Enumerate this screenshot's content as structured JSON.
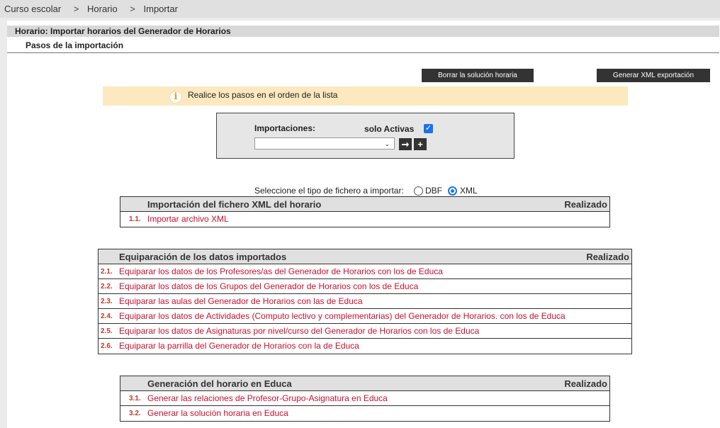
{
  "breadcrumb": [
    "Curso escolar",
    "Horario",
    "Importar"
  ],
  "breadcrumb_sep": ">",
  "page_title": "Horario: Importar horarios del Generador de Horarios",
  "section_title": "Pasos de la importación",
  "buttons": {
    "borrar": "Borrar la solución horaria",
    "generar_xml": "Generar XML exportación"
  },
  "info_message": "Realice los pasos en el orden de la lista",
  "importaciones": {
    "label": "Importaciones:",
    "solo_activas_label": "solo Activas",
    "solo_activas_checked": true,
    "selected_value": ""
  },
  "filetype": {
    "prompt": "Seleccione el tipo de fichero a importar:",
    "options": [
      "DBF",
      "XML"
    ],
    "selected": "XML"
  },
  "tables": [
    {
      "title": "Importación del fichero XML del horario",
      "done_header": "Realizado",
      "rows": [
        {
          "num": "1.1.",
          "label": "Importar archivo XML"
        }
      ]
    },
    {
      "title": "Equiparación de los datos importados",
      "done_header": "Realizado",
      "rows": [
        {
          "num": "2.1.",
          "label": "Equiparar los datos de los Profesores/as del Generador de Horarios con los de Educa"
        },
        {
          "num": "2.2.",
          "label": "Equiparar los datos de los Grupos del Generador de Horarios con los de Educa"
        },
        {
          "num": "2.3.",
          "label": "Equiparar las aulas del Generador de Horarios con las de Educa"
        },
        {
          "num": "2.4.",
          "label": "Equiparar los datos de Actividades (Computo lectivo y complementarias) del Generador de Horarios. con los de Educa"
        },
        {
          "num": "2.5.",
          "label": "Equiparar los datos de Asignaturas por nivel/curso del Generador de Horarios con los de Educa"
        },
        {
          "num": "2.6.",
          "label": "Equiparar la parrilla del Generador de Horarios con la de Educa"
        }
      ]
    },
    {
      "title": "Generación del horario en Educa",
      "done_header": "Realizado",
      "rows": [
        {
          "num": "3.1.",
          "label": "Generar las relaciones de Profesor-Grupo-Asignatura en Educa"
        },
        {
          "num": "3.2.",
          "label": "Generar la solución horaria en Educa"
        }
      ]
    }
  ]
}
